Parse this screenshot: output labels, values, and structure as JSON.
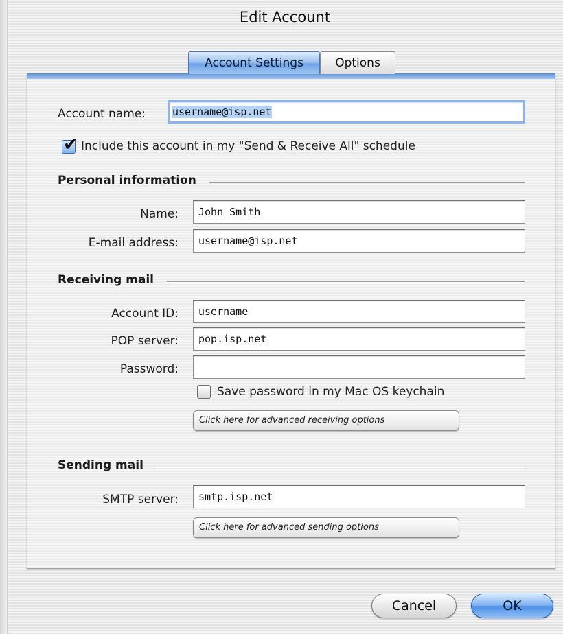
{
  "window": {
    "title": "Edit Account"
  },
  "tabs": [
    {
      "label": "Account Settings",
      "active": true
    },
    {
      "label": "Options",
      "active": false
    }
  ],
  "account": {
    "name_label": "Account name:",
    "name_value": "username@isp.net",
    "include_label": "Include this account in my \"Send & Receive All\" schedule",
    "include_checked": true
  },
  "personal": {
    "heading": "Personal information",
    "name_label": "Name:",
    "name_value": "John Smith",
    "email_label": "E-mail address:",
    "email_value": "username@isp.net"
  },
  "receiving": {
    "heading": "Receiving mail",
    "account_id_label": "Account ID:",
    "account_id_value": "username",
    "pop_label": "POP server:",
    "pop_value": "pop.isp.net",
    "password_label": "Password:",
    "password_value": "",
    "keychain_label": "Save password in my Mac OS keychain",
    "keychain_checked": false,
    "advanced_label": "Click here for advanced receiving options"
  },
  "sending": {
    "heading": "Sending mail",
    "smtp_label": "SMTP server:",
    "smtp_value": "smtp.isp.net",
    "advanced_label": "Click here for advanced sending options"
  },
  "buttons": {
    "cancel": "Cancel",
    "ok": "OK"
  },
  "colors": {
    "accent": "#6fa3e6",
    "selection": "#b5d3f7",
    "focus_ring": "#8ab3ea"
  }
}
